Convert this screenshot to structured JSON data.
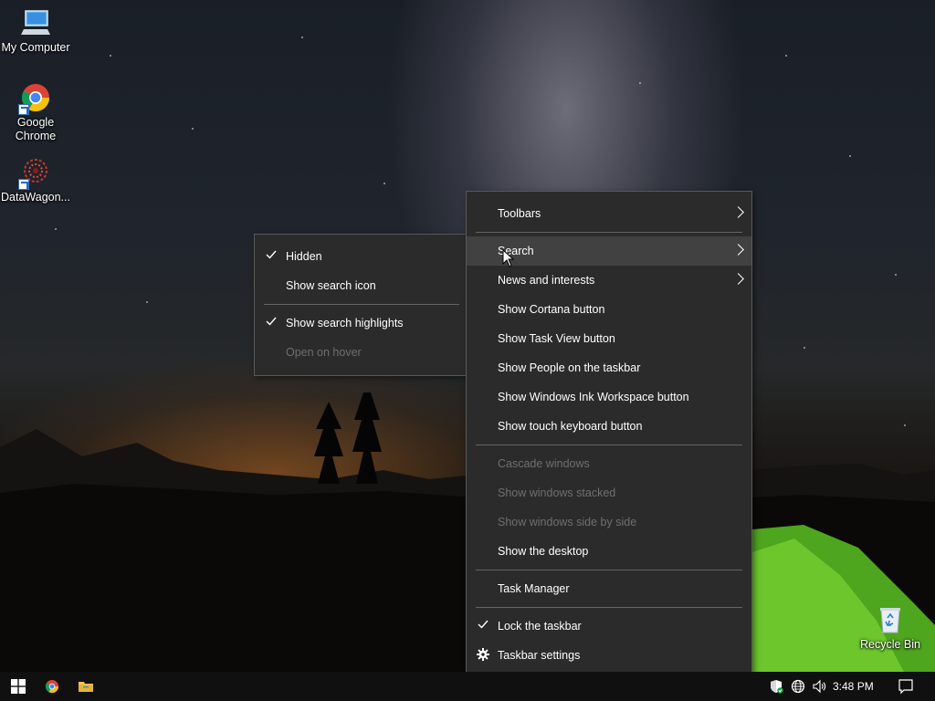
{
  "desktop": {
    "icons": [
      {
        "label": "My Computer",
        "icon": "computer-icon"
      },
      {
        "label": "Google Chrome",
        "icon": "chrome-icon"
      },
      {
        "label": "DataWagon...",
        "icon": "datawagon-icon"
      },
      {
        "label": "Recycle Bin",
        "icon": "recycle-bin-icon"
      }
    ]
  },
  "context_menu": {
    "items": [
      {
        "label": "Toolbars",
        "submenu": true
      },
      {
        "label": "Search",
        "submenu": true,
        "highlighted": true
      },
      {
        "label": "News and interests",
        "submenu": true
      },
      {
        "label": "Show Cortana button"
      },
      {
        "label": "Show Task View button"
      },
      {
        "label": "Show People on the taskbar"
      },
      {
        "label": "Show Windows Ink Workspace button"
      },
      {
        "label": "Show touch keyboard button"
      },
      {
        "label": "Cascade windows",
        "disabled": true
      },
      {
        "label": "Show windows stacked",
        "disabled": true
      },
      {
        "label": "Show windows side by side",
        "disabled": true
      },
      {
        "label": "Show the desktop"
      },
      {
        "label": "Task Manager"
      },
      {
        "label": "Lock the taskbar",
        "checked": true
      },
      {
        "label": "Taskbar settings",
        "icon": "gear-icon"
      }
    ]
  },
  "search_submenu": {
    "items": [
      {
        "label": "Hidden",
        "checked": true
      },
      {
        "label": "Show search icon"
      },
      {
        "label": "Show search highlights",
        "checked": true
      },
      {
        "label": "Open on hover",
        "disabled": true
      }
    ]
  },
  "taskbar": {
    "pinned": [
      "windows-start-icon",
      "chrome-icon",
      "file-explorer-icon"
    ],
    "tray_icons": [
      "security-shield-icon",
      "network-globe-icon",
      "volume-icon"
    ],
    "clock": "3:48 PM",
    "notification_icon": "action-center-icon"
  },
  "colors": {
    "menu_bg": "#2b2b2b",
    "menu_hover": "#414141",
    "menu_disabled_text": "#6f6f6f",
    "taskbar_bg": "#101010"
  }
}
